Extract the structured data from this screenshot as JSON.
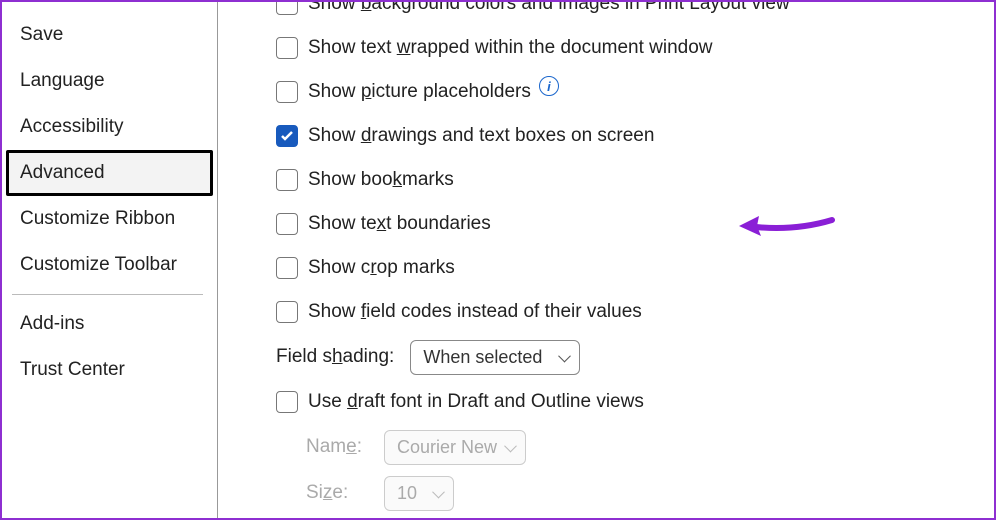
{
  "sidebar": {
    "items": [
      {
        "label": "Save"
      },
      {
        "label": "Language"
      },
      {
        "label": "Accessibility"
      },
      {
        "label": "Advanced",
        "selected": true
      },
      {
        "label": "Customize Ribbon"
      },
      {
        "label": "Customize Toolbar"
      }
    ],
    "items2": [
      {
        "label": "Add-ins"
      },
      {
        "label": "Trust Center"
      }
    ]
  },
  "options": {
    "bg_colors": {
      "pre": "Show ",
      "uchar": "b",
      "post": "ackground colors and images in Print Layout view",
      "checked": false
    },
    "wrapped": {
      "pre": "Show text ",
      "uchar": "w",
      "post": "rapped within the document window",
      "checked": false
    },
    "picture": {
      "pre": "Show ",
      "uchar": "p",
      "post": "icture placeholders",
      "checked": false
    },
    "drawings": {
      "pre": "Show ",
      "uchar": "d",
      "post": "rawings and text boxes on screen",
      "checked": true
    },
    "bookmarks": {
      "pre": "Show boo",
      "uchar": "k",
      "post": "marks",
      "checked": false
    },
    "textbound": {
      "pre": "Show te",
      "uchar": "x",
      "post": "t boundaries",
      "checked": false
    },
    "cropmarks": {
      "pre": "Show c",
      "uchar": "r",
      "post": "op marks",
      "checked": false
    },
    "fieldcodes": {
      "pre": "Show ",
      "uchar": "f",
      "post": "ield codes instead of their values",
      "checked": false
    },
    "draftfont": {
      "pre": "Use ",
      "uchar": "d",
      "post": "raft font in Draft and Outline views",
      "checked": false
    }
  },
  "fields": {
    "shading_label_pre": "Field s",
    "shading_label_u": "h",
    "shading_label_post": "ading:",
    "shading_value": "When selected",
    "name_label_pre": "Nam",
    "name_label_u": "e",
    "name_label_post": ":",
    "name_value": "Courier New",
    "size_label_pre": "Si",
    "size_label_u": "z",
    "size_label_post": "e:",
    "size_value": "10"
  }
}
